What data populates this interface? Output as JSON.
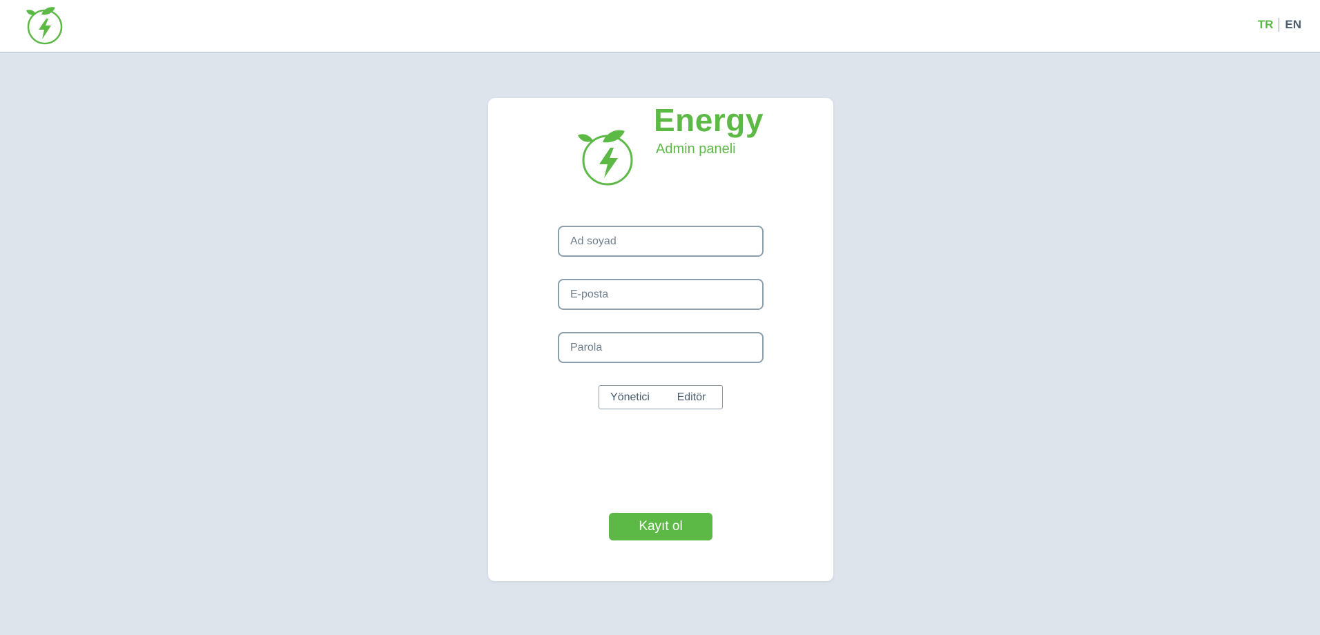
{
  "header": {
    "logo_icon": "energy-leaf-bolt-icon",
    "lang_tr": "TR",
    "lang_en": "EN",
    "active_lang": "TR"
  },
  "brand": {
    "name": "Energy",
    "subtitle": "Admin paneli"
  },
  "form": {
    "name_placeholder": "Ad soyad",
    "email_placeholder": "E-posta",
    "password_placeholder": "Parola",
    "roles": [
      "Yönetici",
      "Editör"
    ],
    "submit_label": "Kayıt ol"
  },
  "colors": {
    "brand_green": "#5cb946",
    "background": "#dde4eb",
    "text_dark": "#4a5d6e"
  }
}
